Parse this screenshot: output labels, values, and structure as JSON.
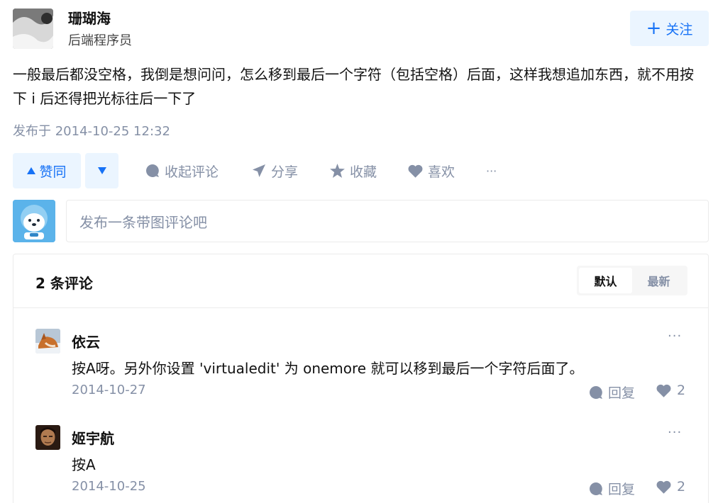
{
  "author": {
    "name": "珊瑚海",
    "headline": "后端程序员",
    "follow_label": "关注"
  },
  "answer": {
    "text": "一般最后都没空格，我倒是想问问，怎么移到最后一个字符（包括空格）后面，这样我想追加东西，就不用按下 i 后还得把光标往后一下了",
    "published": "发布于 2014-10-25 12:32"
  },
  "actions": {
    "upvote_label": "赞同",
    "collapse_comments_label": "收起评论",
    "share_label": "分享",
    "favorite_label": "收藏",
    "like_label": "喜欢",
    "more_label": "···"
  },
  "comment_editor": {
    "placeholder": "发布一条带图评论吧"
  },
  "comments": {
    "count_label": "2 条评论",
    "sort_options": [
      "默认",
      "最新"
    ],
    "active_sort": "默认",
    "items": [
      {
        "author": "依云",
        "text": "按A呀。另外你设置 'virtualedit' 为 onemore 就可以移到最后一个字符后面了。",
        "date": "2014-10-27",
        "reply_label": "回复",
        "likes": "2"
      },
      {
        "author": "姬宇航",
        "text": "按A",
        "date": "2014-10-25",
        "reply_label": "回复",
        "likes": "2"
      }
    ]
  },
  "colors": {
    "brand_blue": "#1772f6",
    "brand_blue_bg": "#ebf5ff",
    "muted_text": "#8590a6",
    "border": "#ebebeb"
  }
}
